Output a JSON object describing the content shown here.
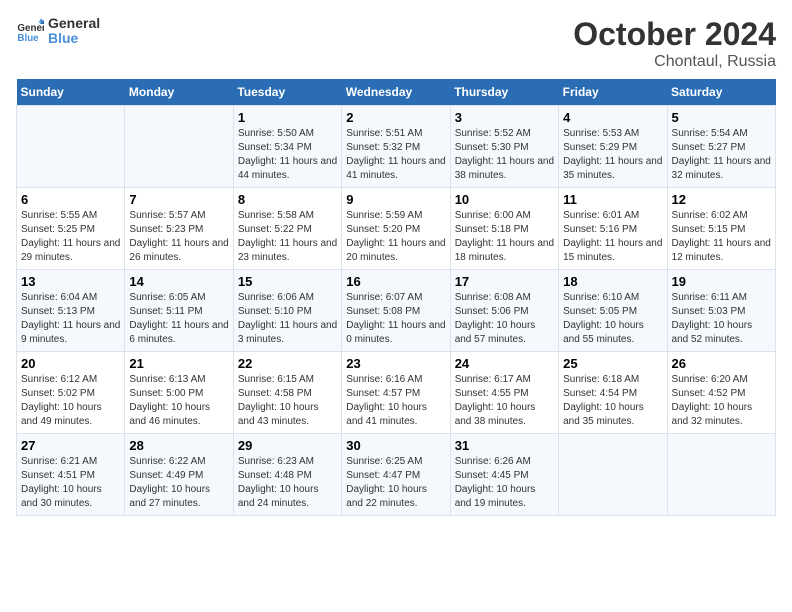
{
  "logo": {
    "line1": "General",
    "line2": "Blue"
  },
  "title": "October 2024",
  "location": "Chontaul, Russia",
  "days_header": [
    "Sunday",
    "Monday",
    "Tuesday",
    "Wednesday",
    "Thursday",
    "Friday",
    "Saturday"
  ],
  "weeks": [
    [
      {
        "day": "",
        "info": ""
      },
      {
        "day": "",
        "info": ""
      },
      {
        "day": "1",
        "info": "Sunrise: 5:50 AM\nSunset: 5:34 PM\nDaylight: 11 hours and 44 minutes."
      },
      {
        "day": "2",
        "info": "Sunrise: 5:51 AM\nSunset: 5:32 PM\nDaylight: 11 hours and 41 minutes."
      },
      {
        "day": "3",
        "info": "Sunrise: 5:52 AM\nSunset: 5:30 PM\nDaylight: 11 hours and 38 minutes."
      },
      {
        "day": "4",
        "info": "Sunrise: 5:53 AM\nSunset: 5:29 PM\nDaylight: 11 hours and 35 minutes."
      },
      {
        "day": "5",
        "info": "Sunrise: 5:54 AM\nSunset: 5:27 PM\nDaylight: 11 hours and 32 minutes."
      }
    ],
    [
      {
        "day": "6",
        "info": "Sunrise: 5:55 AM\nSunset: 5:25 PM\nDaylight: 11 hours and 29 minutes."
      },
      {
        "day": "7",
        "info": "Sunrise: 5:57 AM\nSunset: 5:23 PM\nDaylight: 11 hours and 26 minutes."
      },
      {
        "day": "8",
        "info": "Sunrise: 5:58 AM\nSunset: 5:22 PM\nDaylight: 11 hours and 23 minutes."
      },
      {
        "day": "9",
        "info": "Sunrise: 5:59 AM\nSunset: 5:20 PM\nDaylight: 11 hours and 20 minutes."
      },
      {
        "day": "10",
        "info": "Sunrise: 6:00 AM\nSunset: 5:18 PM\nDaylight: 11 hours and 18 minutes."
      },
      {
        "day": "11",
        "info": "Sunrise: 6:01 AM\nSunset: 5:16 PM\nDaylight: 11 hours and 15 minutes."
      },
      {
        "day": "12",
        "info": "Sunrise: 6:02 AM\nSunset: 5:15 PM\nDaylight: 11 hours and 12 minutes."
      }
    ],
    [
      {
        "day": "13",
        "info": "Sunrise: 6:04 AM\nSunset: 5:13 PM\nDaylight: 11 hours and 9 minutes."
      },
      {
        "day": "14",
        "info": "Sunrise: 6:05 AM\nSunset: 5:11 PM\nDaylight: 11 hours and 6 minutes."
      },
      {
        "day": "15",
        "info": "Sunrise: 6:06 AM\nSunset: 5:10 PM\nDaylight: 11 hours and 3 minutes."
      },
      {
        "day": "16",
        "info": "Sunrise: 6:07 AM\nSunset: 5:08 PM\nDaylight: 11 hours and 0 minutes."
      },
      {
        "day": "17",
        "info": "Sunrise: 6:08 AM\nSunset: 5:06 PM\nDaylight: 10 hours and 57 minutes."
      },
      {
        "day": "18",
        "info": "Sunrise: 6:10 AM\nSunset: 5:05 PM\nDaylight: 10 hours and 55 minutes."
      },
      {
        "day": "19",
        "info": "Sunrise: 6:11 AM\nSunset: 5:03 PM\nDaylight: 10 hours and 52 minutes."
      }
    ],
    [
      {
        "day": "20",
        "info": "Sunrise: 6:12 AM\nSunset: 5:02 PM\nDaylight: 10 hours and 49 minutes."
      },
      {
        "day": "21",
        "info": "Sunrise: 6:13 AM\nSunset: 5:00 PM\nDaylight: 10 hours and 46 minutes."
      },
      {
        "day": "22",
        "info": "Sunrise: 6:15 AM\nSunset: 4:58 PM\nDaylight: 10 hours and 43 minutes."
      },
      {
        "day": "23",
        "info": "Sunrise: 6:16 AM\nSunset: 4:57 PM\nDaylight: 10 hours and 41 minutes."
      },
      {
        "day": "24",
        "info": "Sunrise: 6:17 AM\nSunset: 4:55 PM\nDaylight: 10 hours and 38 minutes."
      },
      {
        "day": "25",
        "info": "Sunrise: 6:18 AM\nSunset: 4:54 PM\nDaylight: 10 hours and 35 minutes."
      },
      {
        "day": "26",
        "info": "Sunrise: 6:20 AM\nSunset: 4:52 PM\nDaylight: 10 hours and 32 minutes."
      }
    ],
    [
      {
        "day": "27",
        "info": "Sunrise: 6:21 AM\nSunset: 4:51 PM\nDaylight: 10 hours and 30 minutes."
      },
      {
        "day": "28",
        "info": "Sunrise: 6:22 AM\nSunset: 4:49 PM\nDaylight: 10 hours and 27 minutes."
      },
      {
        "day": "29",
        "info": "Sunrise: 6:23 AM\nSunset: 4:48 PM\nDaylight: 10 hours and 24 minutes."
      },
      {
        "day": "30",
        "info": "Sunrise: 6:25 AM\nSunset: 4:47 PM\nDaylight: 10 hours and 22 minutes."
      },
      {
        "day": "31",
        "info": "Sunrise: 6:26 AM\nSunset: 4:45 PM\nDaylight: 10 hours and 19 minutes."
      },
      {
        "day": "",
        "info": ""
      },
      {
        "day": "",
        "info": ""
      }
    ]
  ]
}
